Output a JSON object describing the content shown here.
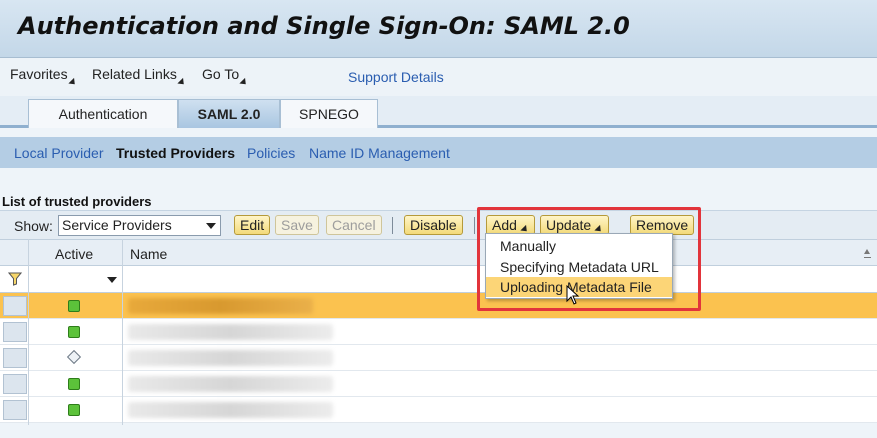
{
  "header": {
    "title": "Authentication and Single Sign-On: SAML 2.0"
  },
  "menubar": {
    "items": [
      "Favorites",
      "Related Links",
      "Go To"
    ],
    "support": "Support Details"
  },
  "tabs": [
    "Authentication",
    "SAML 2.0",
    "SPNEGO"
  ],
  "subnav": [
    "Local Provider",
    "Trusted Providers",
    "Policies",
    "Name ID Management"
  ],
  "list": {
    "title": "List of trusted providers",
    "show_label": "Show:",
    "show_value": "Service Providers",
    "buttons": {
      "edit": "Edit",
      "save": "Save",
      "cancel": "Cancel",
      "disable": "Disable",
      "add": "Add",
      "update": "Update",
      "remove": "Remove"
    },
    "columns": {
      "active": "Active",
      "name": "Name"
    }
  },
  "add_menu": [
    "Manually",
    "Specifying Metadata URL",
    "Uploading Metadata File"
  ],
  "colors": {
    "accent": "#fbc24f",
    "highlight_box": "#e2343b",
    "button": "#f3da7a"
  }
}
